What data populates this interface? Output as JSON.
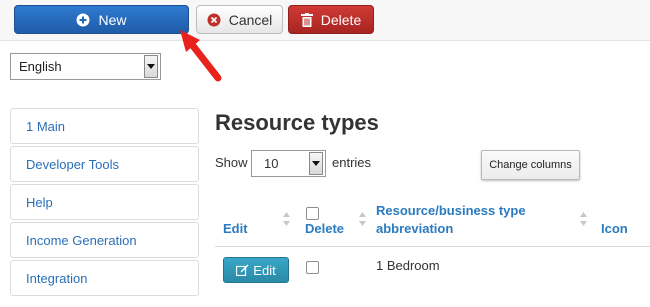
{
  "toolbar": {
    "new_label": "New",
    "cancel_label": "Cancel",
    "delete_label": "Delete"
  },
  "language_select": {
    "value": "English"
  },
  "sidebar": {
    "items": [
      {
        "label": "1 Main"
      },
      {
        "label": "Developer Tools"
      },
      {
        "label": "Help"
      },
      {
        "label": "Income Generation"
      },
      {
        "label": "Integration"
      }
    ]
  },
  "main": {
    "title": "Resource types",
    "show_label": "Show",
    "entries_value": "10",
    "entries_label": "entries",
    "change_columns_label": "Change columns",
    "table": {
      "headers": {
        "edit": "Edit",
        "delete": "Delete",
        "abbrev_line1": "Resource/business type",
        "abbrev_line2": "abbreviation",
        "icon": "Icon"
      },
      "rows": [
        {
          "edit_button": "Edit",
          "abbreviation": "1 Bedroom"
        }
      ]
    }
  },
  "colors": {
    "new_button": "#2a6fc4",
    "delete_button": "#bd2f2b",
    "edit_button": "#2f93b5",
    "link": "#2a6fb6",
    "annotation_arrow": "#e8211b"
  }
}
